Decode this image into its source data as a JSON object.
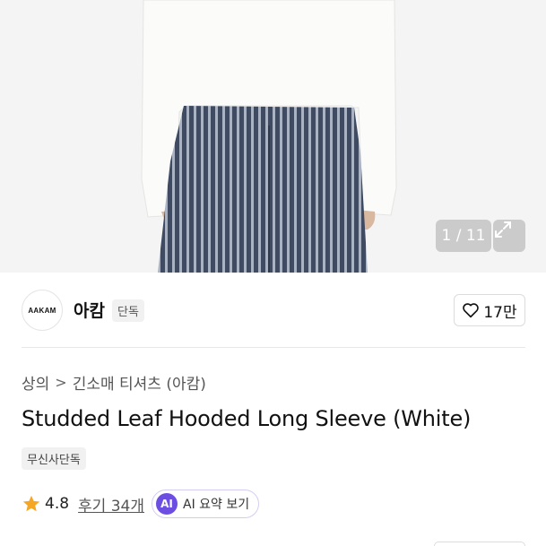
{
  "gallery": {
    "counter": "1 / 11",
    "expand_icon": "expand-icon"
  },
  "brand": {
    "logo_text": "AAKAM",
    "name": "아캄",
    "badge": "단독",
    "like_icon": "heart-icon",
    "like_count": "17만"
  },
  "breadcrumb": {
    "items": [
      "상의",
      "긴소매 티셔츠 (아캄)"
    ],
    "separator": ">"
  },
  "product": {
    "title": "Studded Leaf Hooded Long Sleeve (White)",
    "tag": "무신사단독"
  },
  "rating": {
    "star_icon": "star-icon",
    "value": "4.8",
    "reviews": "후기 34개",
    "ai_label": "AI",
    "ai_text": "AI 요약 보기"
  },
  "colors": {
    "ai_purple": "#6c4ee3",
    "star": "#f5a623"
  }
}
